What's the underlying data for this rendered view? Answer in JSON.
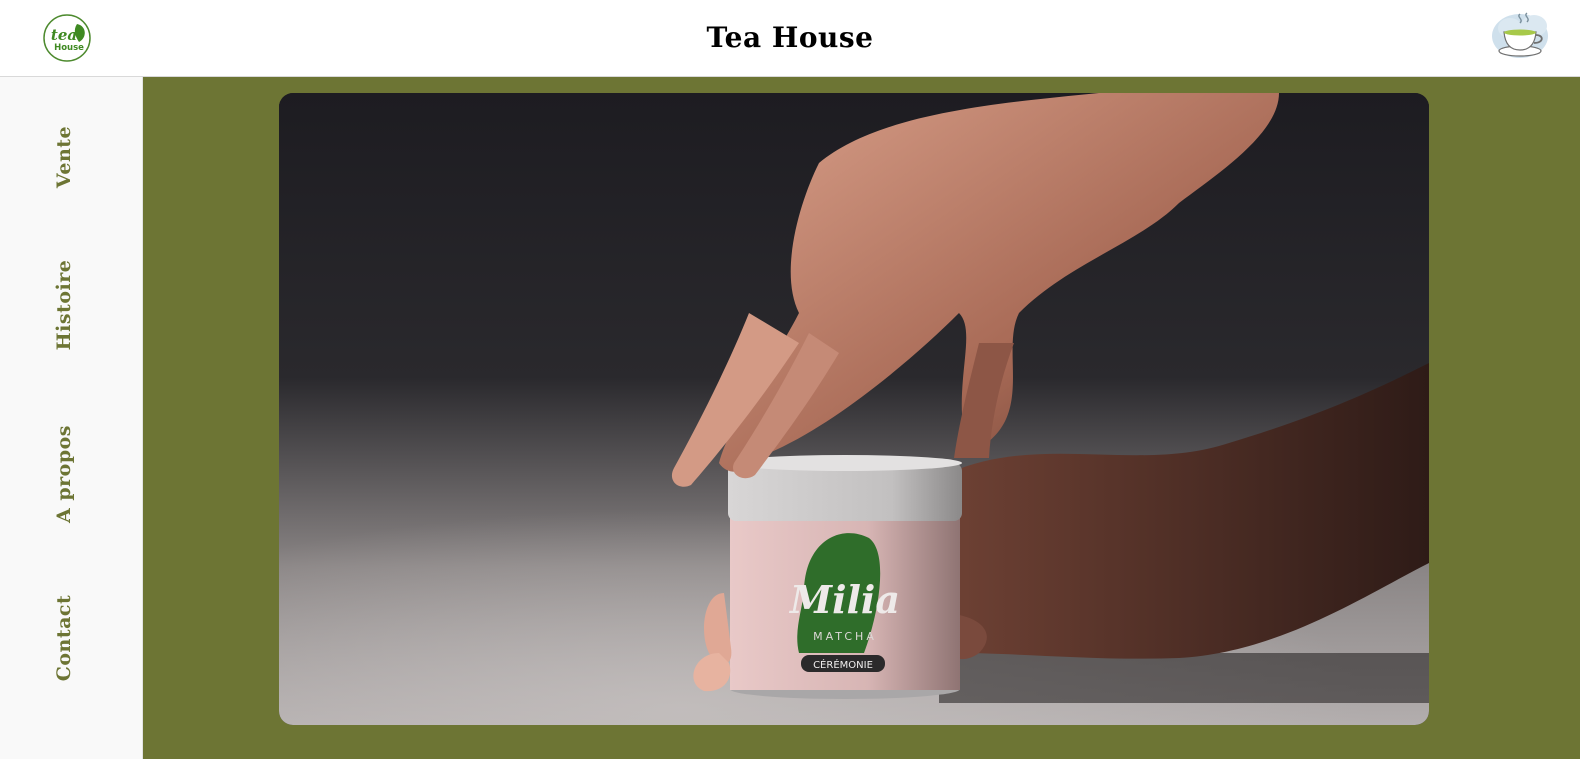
{
  "header": {
    "title": "Tea House",
    "logo_text_top": "tea",
    "logo_text_bottom": "House",
    "logo_icon": "tea-house-logo-icon",
    "cup_icon": "tea-cup-icon"
  },
  "sidebar": {
    "items": [
      {
        "label": "Vente"
      },
      {
        "label": "Histoire"
      },
      {
        "label": "A propos"
      },
      {
        "label": "Contact"
      }
    ]
  },
  "hero": {
    "product_brand": "Milia",
    "product_sub": "MATCHA",
    "product_label": "CÉRÉMONIE"
  },
  "colors": {
    "accent": "#6d7534",
    "sidebar_bg": "#f9f9f9",
    "header_bg": "#ffffff",
    "title": "#000000"
  }
}
